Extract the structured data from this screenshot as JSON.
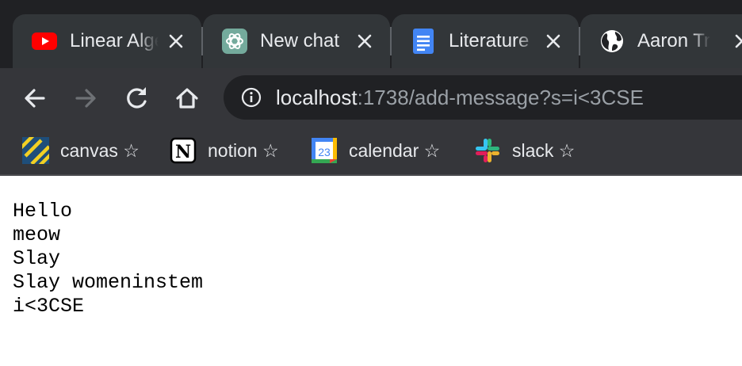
{
  "tabs": [
    {
      "title": "Linear Algebra",
      "favicon": "youtube-icon",
      "active": false
    },
    {
      "title": "New chat",
      "favicon": "chatgpt-icon",
      "active": false
    },
    {
      "title": "Literature",
      "favicon": "google-docs-icon",
      "active": false
    },
    {
      "title": "Aaron Tran",
      "favicon": "globe-icon",
      "active": false
    }
  ],
  "toolbar": {
    "back_icon": "back-arrow-icon",
    "forward_icon": "forward-arrow-icon",
    "reload_icon": "reload-icon",
    "home_icon": "home-icon"
  },
  "omnibox": {
    "host": "localhost",
    "rest": ":1738/add-message?s=i<3CSE",
    "info_icon": "info-icon"
  },
  "bookmarks": [
    {
      "label": "canvas ☆",
      "icon": "canvas-icon"
    },
    {
      "label": "notion ☆",
      "icon": "notion-icon"
    },
    {
      "label": "calendar ☆",
      "icon": "calendar-icon"
    },
    {
      "label": "slack ☆",
      "icon": "slack-icon"
    }
  ],
  "calendar_icon_day": "23",
  "notion_icon_letter": "N",
  "page": {
    "messages": [
      "Hello",
      "meow",
      "Slay",
      "Slay womeninstem",
      "i<3CSE"
    ]
  },
  "colors": {
    "tabstrip": "#202124",
    "tab": "#323639",
    "toolbar": "#35363a",
    "omnibox": "#202124",
    "text_light": "#e8eaed",
    "text_dim": "#9aa0a6"
  }
}
